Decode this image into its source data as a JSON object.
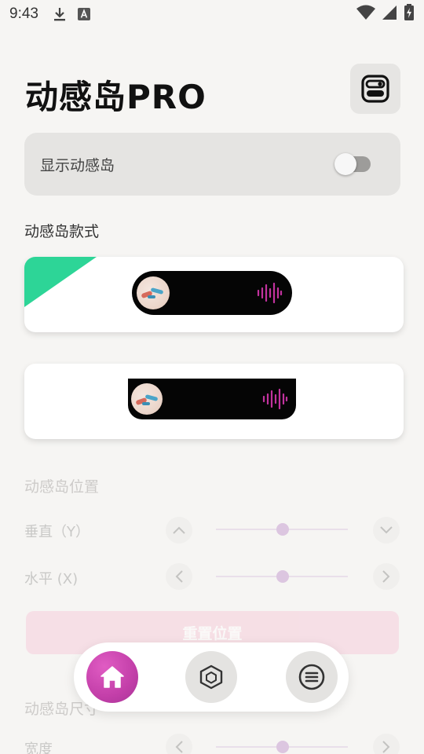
{
  "status_bar": {
    "time": "9:43",
    "icons": [
      "download-icon",
      "accessibility-a-icon",
      "wifi-icon",
      "signal-icon",
      "battery-charging-icon"
    ]
  },
  "header": {
    "title": "动感岛PRO",
    "settings_icon": "toggles-icon"
  },
  "show_island": {
    "label": "显示动感岛",
    "enabled": false
  },
  "styles_section": {
    "title": "动感岛款式",
    "options": [
      {
        "shape": "pill",
        "selected": true,
        "icons": [
          "album-art",
          "waveform-icon"
        ]
      },
      {
        "shape": "notch",
        "selected": false,
        "icons": [
          "album-art",
          "waveform-icon"
        ]
      }
    ]
  },
  "position_section": {
    "title": "动感岛位置",
    "vertical_label": "垂直（Y）",
    "horizontal_label": "水平 (X)",
    "vertical_value": 0.5,
    "horizontal_value": 0.5
  },
  "reset_button": {
    "label": "重置位置"
  },
  "size_section": {
    "title": "动感岛尺寸",
    "width_label": "宽度"
  },
  "bottom_nav": {
    "items": [
      {
        "icon": "home-icon",
        "active": true
      },
      {
        "icon": "cube-icon",
        "active": false
      },
      {
        "icon": "menu-icon",
        "active": false
      }
    ]
  },
  "colors": {
    "accent": "#c33fa9",
    "selected_corner": "#2dd597",
    "waveform": "#c2329e",
    "background": "#f6f5f3"
  }
}
